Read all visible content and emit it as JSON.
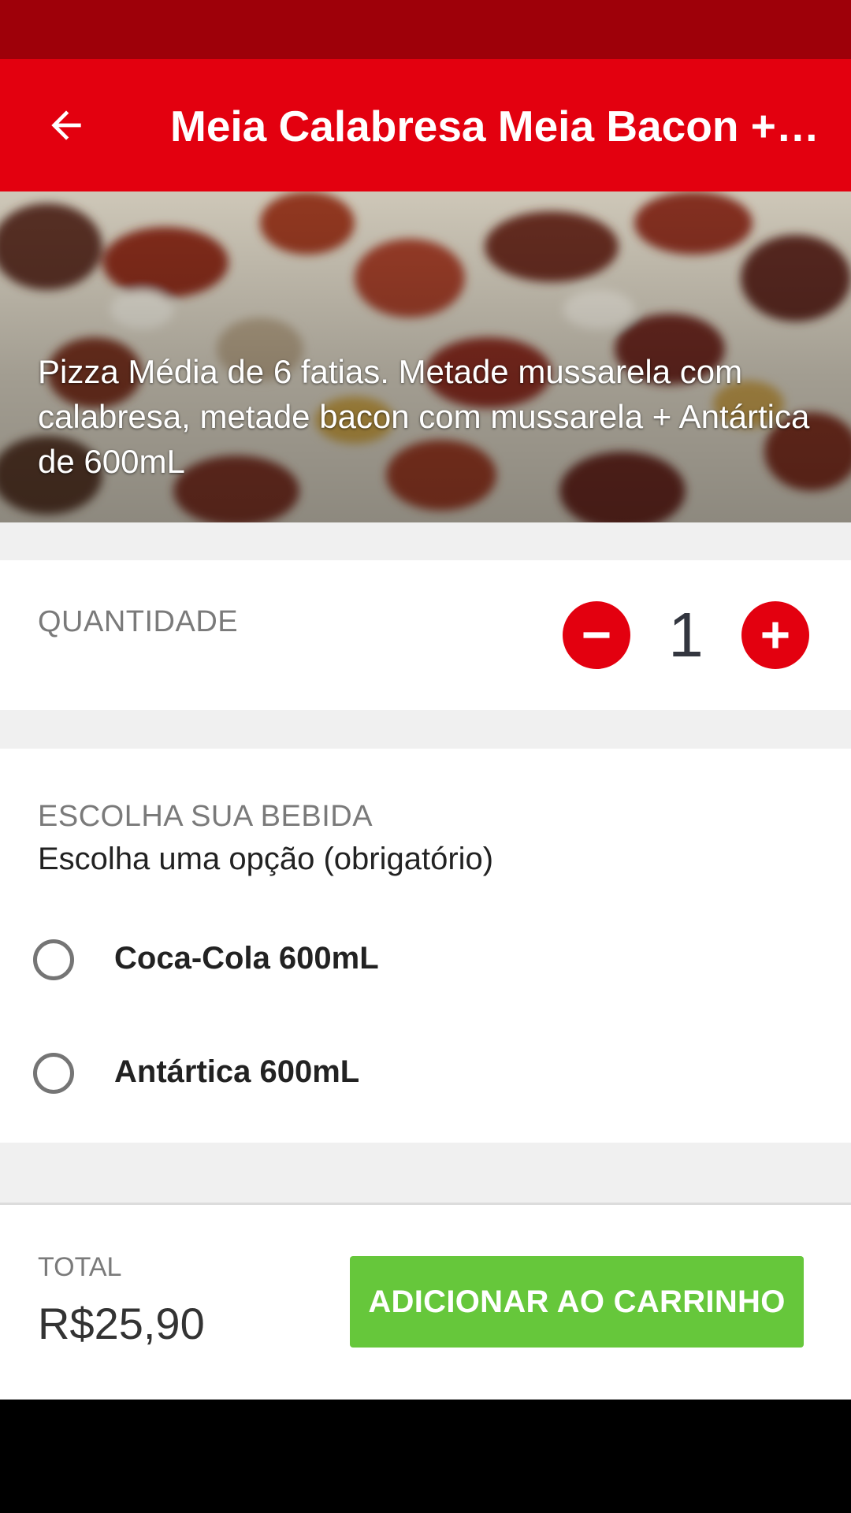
{
  "colors": {
    "status_bar": "#9e0009",
    "app_bar": "#e3000f",
    "accent": "#e3000f",
    "cta": "#66c73b",
    "background": "#f0f0f0"
  },
  "header": {
    "back_icon": "arrow-left-icon",
    "title": "Meia Calabresa Meia Bacon + Antártica"
  },
  "product": {
    "description": "Pizza Média de 6 fatias. Metade mussarela com calabresa, metade bacon com mussarela + Antártica de 600mL"
  },
  "quantity": {
    "label": "QUANTIDADE",
    "value": "1",
    "minus_icon": "minus-icon",
    "plus_icon": "plus-icon"
  },
  "drink": {
    "label": "ESCOLHA SUA BEBIDA",
    "subtitle": "Escolha uma opção (obrigatório)",
    "options": [
      {
        "label": "Coca-Cola 600mL",
        "selected": false
      },
      {
        "label": "Antártica 600mL",
        "selected": false
      }
    ]
  },
  "footer": {
    "total_label": "TOTAL",
    "total_value": "R$25,90",
    "add_button": "ADICIONAR AO CARRINHO"
  }
}
